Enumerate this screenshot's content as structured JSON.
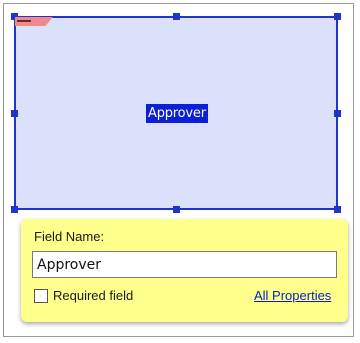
{
  "field": {
    "name_label": "Approver"
  },
  "panel": {
    "title": "Field Name:",
    "name_value": "Approver",
    "required_label": "Required field",
    "required_checked": false,
    "all_properties_link": "All Properties"
  },
  "colors": {
    "selection": "#1f34c9",
    "field_fill": "#dbe1fb",
    "panel_bg": "#ffff8c",
    "tag": "#f08a8a"
  }
}
